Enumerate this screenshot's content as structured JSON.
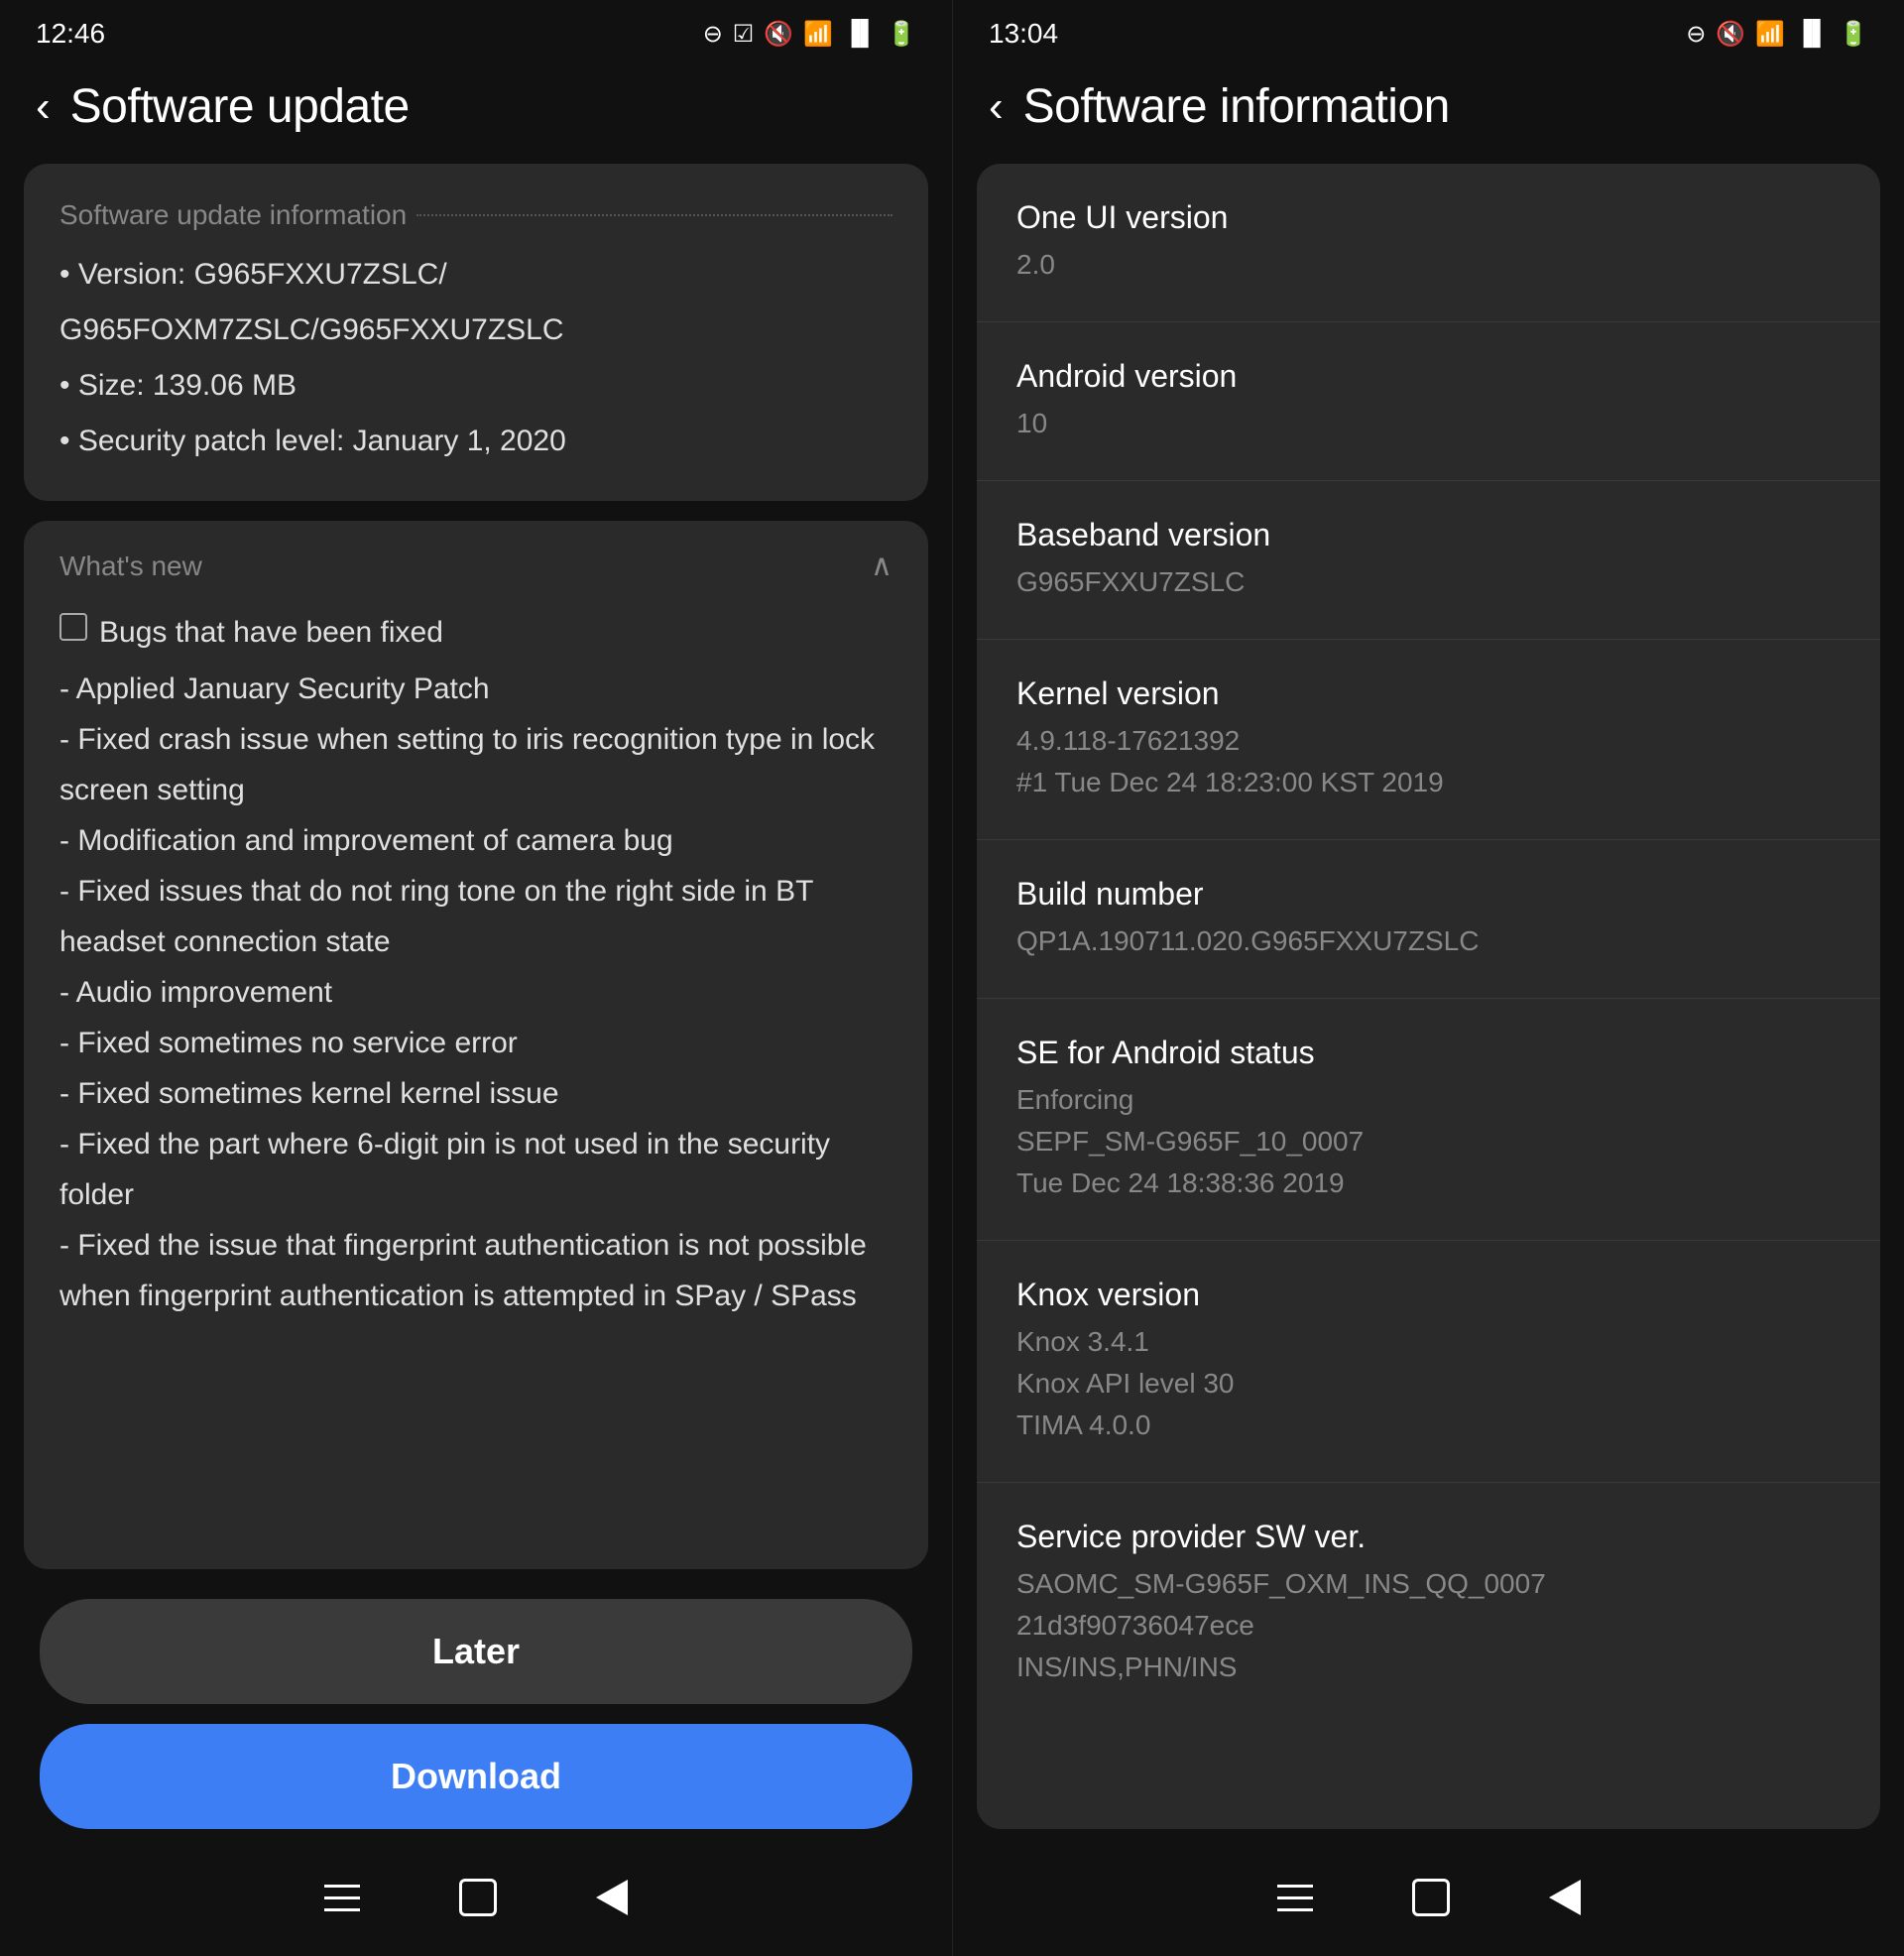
{
  "left": {
    "status_bar": {
      "time": "12:46",
      "icons": [
        "minus-circle",
        "checkmark",
        "mute",
        "wifi",
        "signal",
        "battery"
      ]
    },
    "header": {
      "back_label": "‹",
      "title": "Software update"
    },
    "update_info": {
      "section_title": "Software update information",
      "items": [
        "• Version: G965FXXU7ZSLC/",
        "  G965FOXM7ZSLC/G965FXXU7ZSLC",
        "• Size: 139.06 MB",
        "• Security patch level: January 1, 2020"
      ]
    },
    "whats_new": {
      "title": "What's new",
      "changelog": [
        "Bugs that have been fixed",
        " - Applied January Security Patch",
        " - Fixed crash issue when setting to iris recognition type in lock screen setting",
        " - Modification and improvement of camera bug",
        " - Fixed issues that do not ring tone on the right side in BT headset connection state",
        " - Audio improvement",
        " - Fixed sometimes no service error",
        " - Fixed sometimes kernel kernel issue",
        " - Fixed the part where 6-digit pin is not used in the security folder",
        " - Fixed the issue that fingerprint authentication is not possible when fingerprint authentication is attempted in SPay / SPass"
      ]
    },
    "buttons": {
      "later_label": "Later",
      "download_label": "Download"
    },
    "nav": {
      "recent": "recent",
      "home": "home",
      "back": "back"
    }
  },
  "right": {
    "status_bar": {
      "time": "13:04",
      "icons": [
        "minus-circle",
        "mute",
        "wifi",
        "signal",
        "battery"
      ]
    },
    "header": {
      "back_label": "‹",
      "title": "Software information"
    },
    "info_rows": [
      {
        "label": "One UI version",
        "value": "2.0"
      },
      {
        "label": "Android version",
        "value": "10"
      },
      {
        "label": "Baseband version",
        "value": "G965FXXU7ZSLC"
      },
      {
        "label": "Kernel version",
        "value": "4.9.118-17621392\n#1 Tue Dec 24 18:23:00 KST 2019"
      },
      {
        "label": "Build number",
        "value": "QP1A.190711.020.G965FXXU7ZSLC"
      },
      {
        "label": "SE for Android status",
        "value": "Enforcing\nSEPF_SM-G965F_10_0007\nTue Dec 24 18:38:36 2019"
      },
      {
        "label": "Knox version",
        "value": "Knox 3.4.1\nKnox API level 30\nTIMA 4.0.0"
      },
      {
        "label": "Service provider SW ver.",
        "value": "SAOMC_SM-G965F_OXM_INS_QQ_0007\n21d3f90736047ece\nINS/INS,PHN/INS"
      }
    ],
    "nav": {
      "recent": "recent",
      "home": "home",
      "back": "back"
    }
  }
}
